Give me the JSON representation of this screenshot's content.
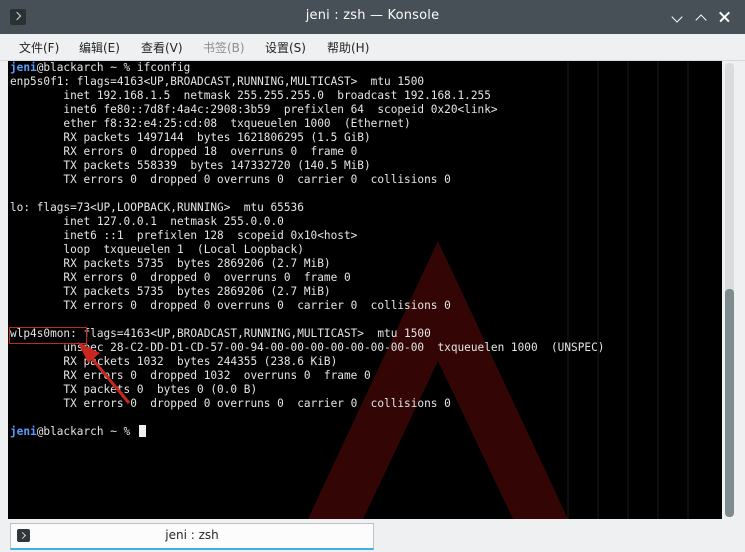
{
  "window": {
    "title": "jeni : zsh — Konsole"
  },
  "menu": [
    {
      "label": "文件(F)",
      "enabled": true
    },
    {
      "label": "编辑(E)",
      "enabled": true
    },
    {
      "label": "查看(V)",
      "enabled": true
    },
    {
      "label": "书签(B)",
      "enabled": false
    },
    {
      "label": "设置(S)",
      "enabled": true
    },
    {
      "label": "帮助(H)",
      "enabled": true
    }
  ],
  "terminal": {
    "prompt": {
      "user": "jeni",
      "host_suffix": "@blackarch ~ % "
    },
    "command": "ifconfig",
    "output": [
      "enp5s0f1: flags=4163<UP,BROADCAST,RUNNING,MULTICAST>  mtu 1500",
      "        inet 192.168.1.5  netmask 255.255.255.0  broadcast 192.168.1.255",
      "        inet6 fe80::7d8f:4a4c:2908:3b59  prefixlen 64  scopeid 0x20<link>",
      "        ether f8:32:e4:25:cd:08  txqueuelen 1000  (Ethernet)",
      "        RX packets 1497144  bytes 1621806295 (1.5 GiB)",
      "        RX errors 0  dropped 18  overruns 0  frame 0",
      "        TX packets 558339  bytes 147332720 (140.5 MiB)",
      "        TX errors 0  dropped 0 overruns 0  carrier 0  collisions 0",
      "",
      "lo: flags=73<UP,LOOPBACK,RUNNING>  mtu 65536",
      "        inet 127.0.0.1  netmask 255.0.0.0",
      "        inet6 ::1  prefixlen 128  scopeid 0x10<host>",
      "        loop  txqueuelen 1  (Local Loopback)",
      "        RX packets 5735  bytes 2869206 (2.7 MiB)",
      "        RX errors 0  dropped 0  overruns 0  frame 0",
      "        TX packets 5735  bytes 2869206 (2.7 MiB)",
      "        TX errors 0  dropped 0 overruns 0  carrier 0  collisions 0",
      "",
      "wlp4s0mon: flags=4163<UP,BROADCAST,RUNNING,MULTICAST>  mtu 1500",
      "        unspec 28-C2-DD-D1-CD-57-00-94-00-00-00-00-00-00-00-00  txqueuelen 1000  (UNSPEC)",
      "        RX packets 1032  bytes 244355 (238.6 KiB)",
      "        RX errors 0  dropped 1032  overruns 0  frame 0",
      "        TX packets 0  bytes 0 (0.0 B)",
      "        TX errors 0  dropped 0 overruns 0  carrier 0  collisions 0",
      ""
    ],
    "highlighted_interface": "wlp4s0mon",
    "annotation_color": "#c8271f",
    "background_color": "#000000",
    "prompt_user_color": "#5c9cff"
  },
  "tab": {
    "label": "jeni : zsh"
  },
  "scrollbar": {
    "position_fraction": 1.0
  }
}
